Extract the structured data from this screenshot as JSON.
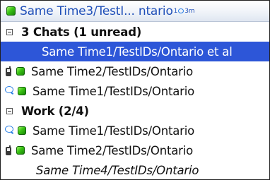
{
  "header": {
    "title": "Same Time3/TestI... ntario",
    "meta_left": "1",
    "meta_right": "3m"
  },
  "groups": [
    {
      "label": "3 Chats (1 unread)",
      "items": [
        {
          "label": "Same Time1/TestIDs/Ontario et al"
        },
        {
          "label": "Same Time2/TestIDs/Ontario"
        },
        {
          "label": "Same Time1/TestIDs/Ontario"
        }
      ]
    },
    {
      "label": "Work (2/4)",
      "items": [
        {
          "label": "Same Time1/TestIDs/Ontario"
        },
        {
          "label": "Same Time2/TestIDs/Ontario"
        },
        {
          "label": "Same Time4/TestIDs/Ontario"
        }
      ]
    }
  ],
  "colors": {
    "header_text": "#1f4fb8",
    "selection": "#2d56d8",
    "online_status": "#3ac414",
    "chat_bubble": "#2a7fe6"
  },
  "icons": {
    "header_status": "online-status-icon",
    "collapse": "collapse-minus-icon",
    "mobile": "mobile-phone-icon",
    "chat": "chat-bubble-icon",
    "online": "online-status-icon"
  }
}
